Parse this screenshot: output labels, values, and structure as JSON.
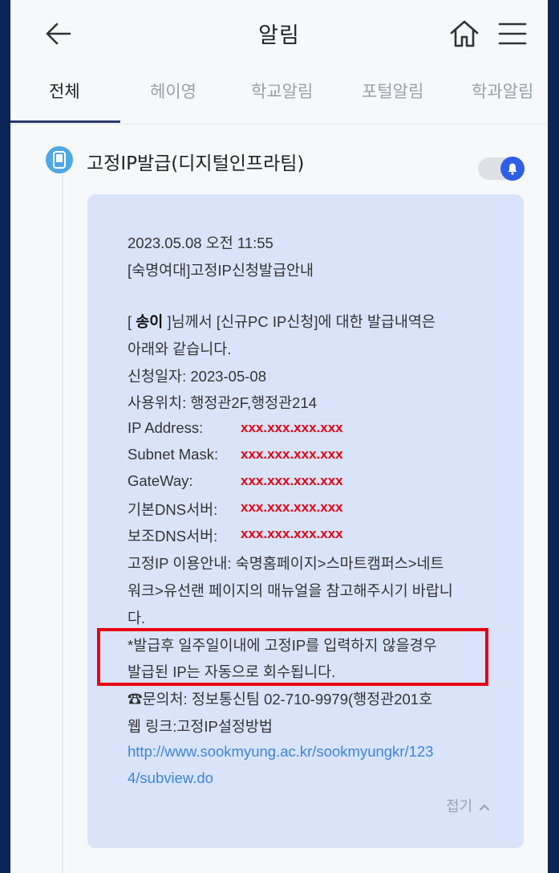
{
  "header": {
    "title": "알림"
  },
  "tabs": [
    {
      "label": "전체",
      "active": true
    },
    {
      "label": "헤이영"
    },
    {
      "label": "학교알림"
    },
    {
      "label": "포털알림"
    },
    {
      "label": "학과알림"
    }
  ],
  "notification": {
    "title": "고정IP발급(디지털인프라팀)",
    "toggle_on": true,
    "datetime": "2023.05.08 오전 11:55",
    "subject": "[숙명여대]고정IP신청발급안내",
    "intro_open": "[ ",
    "name": "송이",
    "intro_rest": " ]님께서 [신규PC IP신청]에 대한 발급내역은",
    "intro_line2": "아래와 같습니다.",
    "apply_date": "신청일자: 2023-05-08",
    "location": "사용위치: 행정관2F,행정관214",
    "fields": [
      {
        "label": "IP Address:",
        "value": "xxx.xxx.xxx.xxx"
      },
      {
        "label": "Subnet Mask:",
        "value": "xxx.xxx.xxx.xxx"
      },
      {
        "label": "GateWay:",
        "value": "xxx.xxx.xxx.xxx"
      },
      {
        "label": "기본DNS서버:",
        "value": "xxx.xxx.xxx.xxx"
      },
      {
        "label": "보조DNS서버:",
        "value": "xxx.xxx.xxx.xxx"
      }
    ],
    "guide_line1": "고정IP 이용안내: 숙명홈페이지>스마트캠퍼스>네트",
    "guide_line2": "워크>유선랜 페이지의 매뉴얼을 참고해주시기 바랍니",
    "guide_line3": "다.",
    "warning_line1": "*발급후 일주일이내에 고정IP를 입력하지 않을경우",
    "warning_line2": "발급된 IP는 자동으로 회수됩니다.",
    "contact": "☎문의처: 정보통신팀 02-710-9979(행정관201호",
    "web_link_label": "웹 링크:고정IP설정방법",
    "url_line1": "http://www.sookmyung.ac.kr/sookmyungkr/123",
    "url_line2": "4/subview.do",
    "collapse_label": "접기"
  },
  "colors": {
    "accent": "#2f5fe6",
    "masked_value": "#e60012",
    "card": "#d9e4fb"
  }
}
